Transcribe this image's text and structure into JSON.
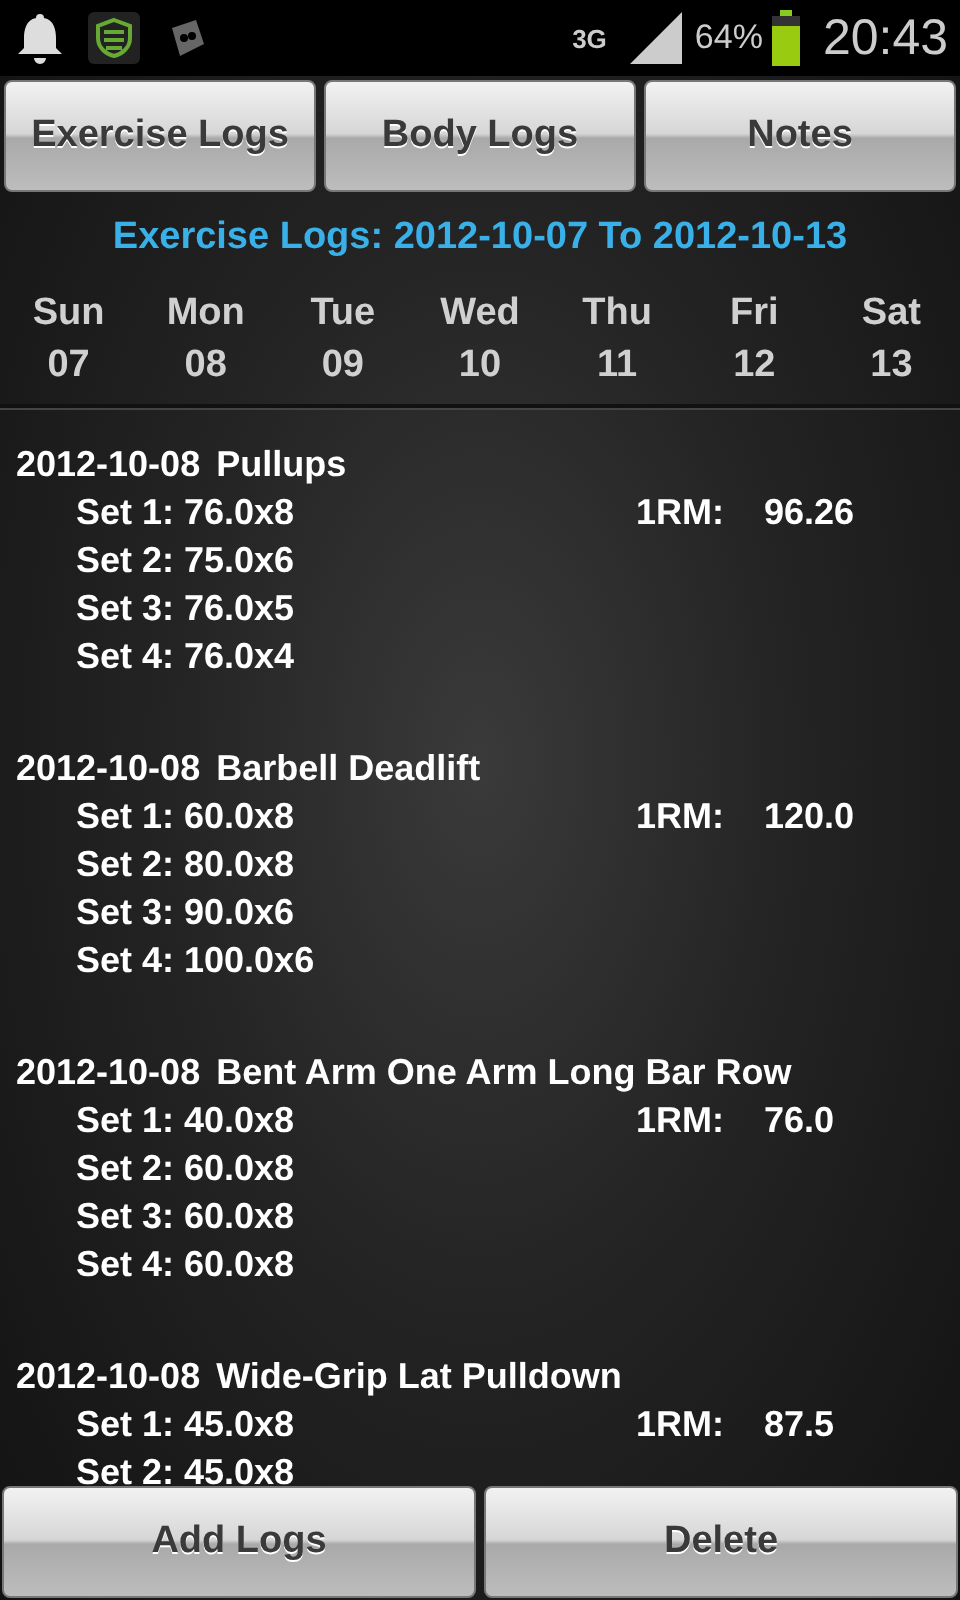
{
  "status_bar": {
    "network": "3G",
    "battery": "64%",
    "time": "20:43"
  },
  "tabs": [
    {
      "label": "Exercise Logs"
    },
    {
      "label": "Body Logs"
    },
    {
      "label": "Notes"
    }
  ],
  "title": "Exercise Logs: 2012-10-07 To 2012-10-13",
  "week": [
    {
      "day": "Sun",
      "date": "07"
    },
    {
      "day": "Mon",
      "date": "08"
    },
    {
      "day": "Tue",
      "date": "09"
    },
    {
      "day": "Wed",
      "date": "10"
    },
    {
      "day": "Thu",
      "date": "11"
    },
    {
      "day": "Fri",
      "date": "12"
    },
    {
      "day": "Sat",
      "date": "13"
    }
  ],
  "logs": [
    {
      "date": "2012-10-08",
      "exercise": "Pullups",
      "one_rm_label": "1RM:",
      "one_rm": "96.26",
      "sets": [
        "Set 1: 76.0x8",
        "Set 2: 75.0x6",
        "Set 3: 76.0x5",
        "Set 4: 76.0x4"
      ]
    },
    {
      "date": "2012-10-08",
      "exercise": "Barbell Deadlift",
      "one_rm_label": "1RM:",
      "one_rm": "120.0",
      "sets": [
        "Set 1: 60.0x8",
        "Set 2: 80.0x8",
        "Set 3: 90.0x6",
        "Set 4: 100.0x6"
      ]
    },
    {
      "date": "2012-10-08",
      "exercise": "Bent Arm One Arm Long Bar Row",
      "one_rm_label": "1RM:",
      "one_rm": "76.0",
      "sets": [
        "Set 1: 40.0x8",
        "Set 2: 60.0x8",
        "Set 3: 60.0x8",
        "Set 4: 60.0x8"
      ]
    },
    {
      "date": "2012-10-08",
      "exercise": "Wide-Grip Lat Pulldown",
      "one_rm_label": "1RM:",
      "one_rm": "87.5",
      "sets": [
        "Set 1: 45.0x8",
        "Set 2: 45.0x8"
      ]
    }
  ],
  "actions": [
    {
      "label": "Add Logs"
    },
    {
      "label": "Delete"
    }
  ]
}
